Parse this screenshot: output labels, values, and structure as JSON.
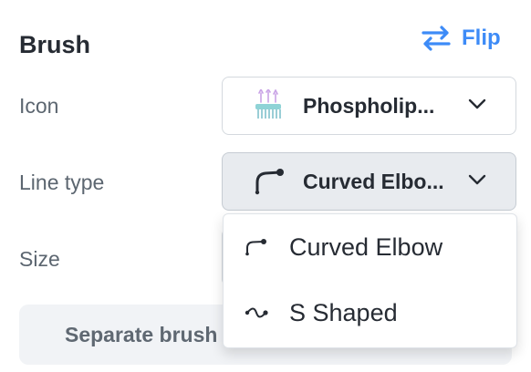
{
  "panel": {
    "title": "Brush",
    "flip_label": "Flip"
  },
  "fields": {
    "icon_label": "Icon",
    "icon_value": "Phospholip...",
    "line_type_label": "Line type",
    "line_type_value": "Curved Elbo...",
    "size_label": "Size"
  },
  "dropdown": {
    "options": [
      {
        "label": "Curved Elbow",
        "icon": "curved-elbow-icon"
      },
      {
        "label": "S Shaped",
        "icon": "s-shaped-icon"
      }
    ]
  },
  "separate_button": {
    "label": "Separate brush"
  },
  "colors": {
    "accent": "#3d8bf7",
    "select_active_bg": "#e8ebef"
  }
}
